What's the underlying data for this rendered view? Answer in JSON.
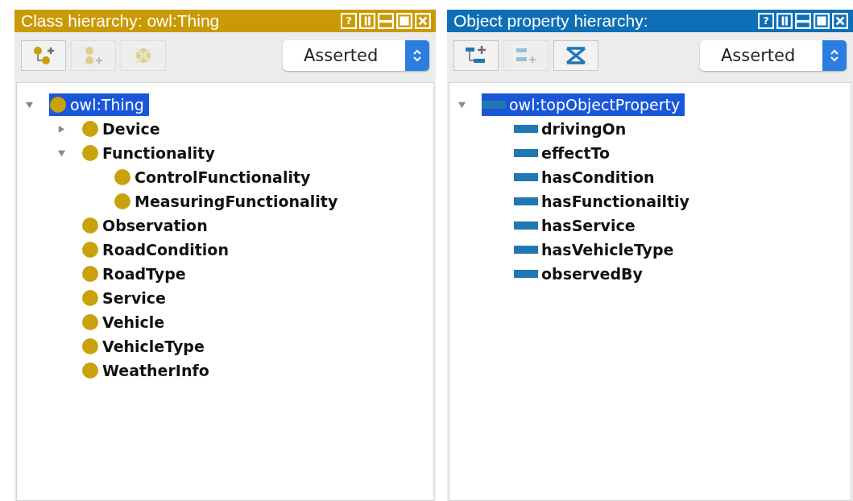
{
  "panels": [
    {
      "kind": "class",
      "title": "Class hierarchy: owl:Thing",
      "header_buttons": [
        {
          "kind": "help",
          "label": "?"
        },
        {
          "kind": "split"
        },
        {
          "kind": "minimize"
        },
        {
          "kind": "maximize"
        },
        {
          "kind": "close"
        }
      ],
      "toolbar": [
        {
          "kind": "add_subclass",
          "disabled": false
        },
        {
          "kind": "add_sibling",
          "disabled": true
        },
        {
          "kind": "delete",
          "disabled": true
        }
      ],
      "view": {
        "value": "Asserted"
      },
      "tree": [
        {
          "label": "owl:Thing",
          "selected": true,
          "expanded": true,
          "children": [
            {
              "label": "Device",
              "selected": false,
              "expanded": false
            },
            {
              "label": "Functionality",
              "selected": false,
              "expanded": true,
              "children": [
                {
                  "label": "ControlFunctionality",
                  "selected": false
                },
                {
                  "label": "MeasuringFunctionality",
                  "selected": false
                }
              ]
            },
            {
              "label": "Observation",
              "selected": false
            },
            {
              "label": "RoadCondition",
              "selected": false
            },
            {
              "label": "RoadType",
              "selected": false
            },
            {
              "label": "Service",
              "selected": false
            },
            {
              "label": "Vehicle",
              "selected": false
            },
            {
              "label": "VehicleType",
              "selected": false
            },
            {
              "label": "WeatherInfo",
              "selected": false
            }
          ]
        }
      ]
    },
    {
      "kind": "object_property",
      "title": "Object property hierarchy:",
      "header_buttons": [
        {
          "kind": "help",
          "label": "?"
        },
        {
          "kind": "split"
        },
        {
          "kind": "minimize"
        },
        {
          "kind": "maximize"
        },
        {
          "kind": "close"
        }
      ],
      "toolbar": [
        {
          "kind": "add_subproperty",
          "disabled": false
        },
        {
          "kind": "add_sibling",
          "disabled": true
        },
        {
          "kind": "delete",
          "disabled": false
        }
      ],
      "view": {
        "value": "Asserted"
      },
      "tree": [
        {
          "label": "owl:topObjectProperty",
          "selected": true,
          "expanded": true,
          "children": [
            {
              "label": "drivingOn",
              "selected": false
            },
            {
              "label": "effectTo",
              "selected": false
            },
            {
              "label": "hasCondition",
              "selected": false
            },
            {
              "label": "hasFunctionailtiy",
              "selected": false
            },
            {
              "label": "hasService",
              "selected": false
            },
            {
              "label": "hasVehicleType",
              "selected": false
            },
            {
              "label": "observedBy",
              "selected": false
            }
          ]
        }
      ]
    }
  ]
}
